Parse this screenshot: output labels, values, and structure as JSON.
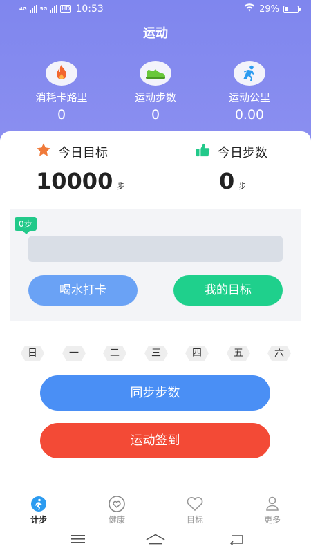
{
  "status_bar": {
    "network_1": "4G",
    "network_2": "5G",
    "hd_badge": "HD",
    "time": "10:53",
    "battery_percent": "29%",
    "battery_level": 0.29
  },
  "page": {
    "title": "运动"
  },
  "stats": [
    {
      "icon": "fire-icon",
      "label": "消耗卡路里",
      "value": "0",
      "accent": "#f2662f"
    },
    {
      "icon": "sneaker-icon",
      "label": "运动步数",
      "value": "0",
      "accent": "#69c83a"
    },
    {
      "icon": "running-icon",
      "label": "运动公里",
      "value": "0.00",
      "accent": "#2c9bf0"
    }
  ],
  "goal": {
    "target_label": "今日目标",
    "target_value": "10000",
    "target_unit": "步",
    "today_label": "今日步数",
    "today_value": "0",
    "today_unit": "步"
  },
  "progress": {
    "badge": "0步",
    "fraction": 0.0,
    "water_button": "喝水打卡",
    "my_goal_button": "我的目标"
  },
  "weekdays": [
    "日",
    "一",
    "二",
    "三",
    "四",
    "五",
    "六"
  ],
  "actions": {
    "sync_button": "同步步数",
    "checkin_button": "运动签到"
  },
  "tabbar": {
    "items": [
      {
        "label": "计步",
        "icon": "walking-icon",
        "active": true
      },
      {
        "label": "健康",
        "icon": "heart-icon",
        "active": false
      },
      {
        "label": "目标",
        "icon": "heart-outline-icon",
        "active": false
      },
      {
        "label": "更多",
        "icon": "person-icon",
        "active": false
      }
    ]
  },
  "colors": {
    "header": "#8089ef",
    "accent_blue": "#4a8ff5",
    "accent_green": "#1fd08c",
    "accent_red": "#f34a36"
  }
}
